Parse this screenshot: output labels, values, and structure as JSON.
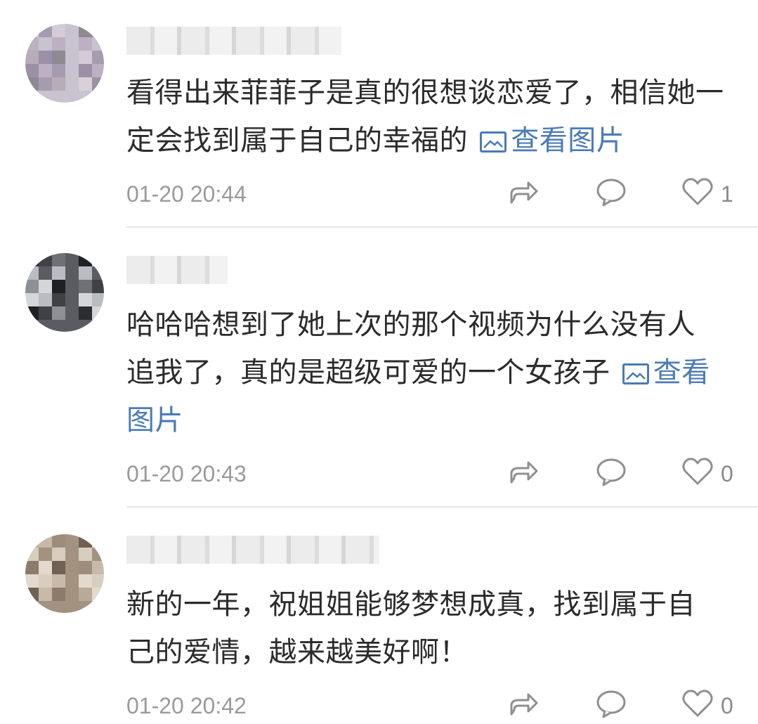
{
  "comments": [
    {
      "text": "看得出来菲菲子是真的很想谈恋爱了，相信她一定会找到属于自己的幸福的",
      "link_label": "查看图片",
      "time": "01-20 20:44",
      "likes": "1",
      "avatar_colors": [
        "#d8d2d8",
        "#c9c2cf",
        "#b7adb9",
        "#a59cb0",
        "#8e8a92",
        "#bcb0c2",
        "#d4cbd6",
        "#9b90a6"
      ]
    },
    {
      "text": "哈哈哈想到了她上次的那个视频为什么没有人追我了，真的是超级可爱的一个女孩子",
      "link_label": "查看图片",
      "time": "01-20 20:43",
      "likes": "0",
      "avatar_colors": [
        "#2c2d30",
        "#5a5c61",
        "#8e9096",
        "#3f4145",
        "#1f2022",
        "#b9bcc2",
        "#6e7075",
        "#d4d6da"
      ]
    },
    {
      "text": "新的一年，祝姐姐能够梦想成真，找到属于自己的爱情，越来越美好啊！",
      "link_label": "",
      "time": "01-20 20:42",
      "likes": "0",
      "avatar_colors": [
        "#b9a998",
        "#a39280",
        "#8c7b6a",
        "#c8baa9",
        "#6f6255",
        "#d8cdbf",
        "#9e8d7b",
        "#e3d9cd"
      ]
    }
  ]
}
